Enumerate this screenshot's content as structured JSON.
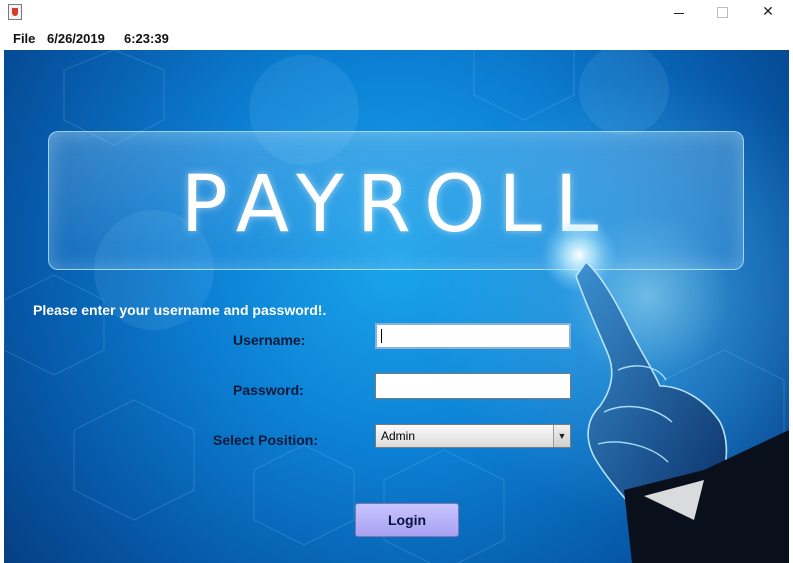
{
  "window": {
    "title": "",
    "controls": {
      "minimize": "minimize-icon",
      "maximize": "maximize-icon",
      "close": "close-icon"
    }
  },
  "menubar": {
    "file_label": "File",
    "date": "6/26/2019",
    "time": "6:23:39"
  },
  "banner": {
    "title": "PAYROLL"
  },
  "form": {
    "prompt": "Please enter your username and password!.",
    "username_label": "Username:",
    "username_value": "",
    "password_label": "Password:",
    "password_value": "",
    "position_label": "Select Position:",
    "position_selected": "Admin"
  },
  "login_button": "Login",
  "colors": {
    "background_blue": "#0c7fd3",
    "login_button": "#b8b1fa",
    "prompt_text": "#ffffff",
    "label_text": "#0a1a3a"
  }
}
